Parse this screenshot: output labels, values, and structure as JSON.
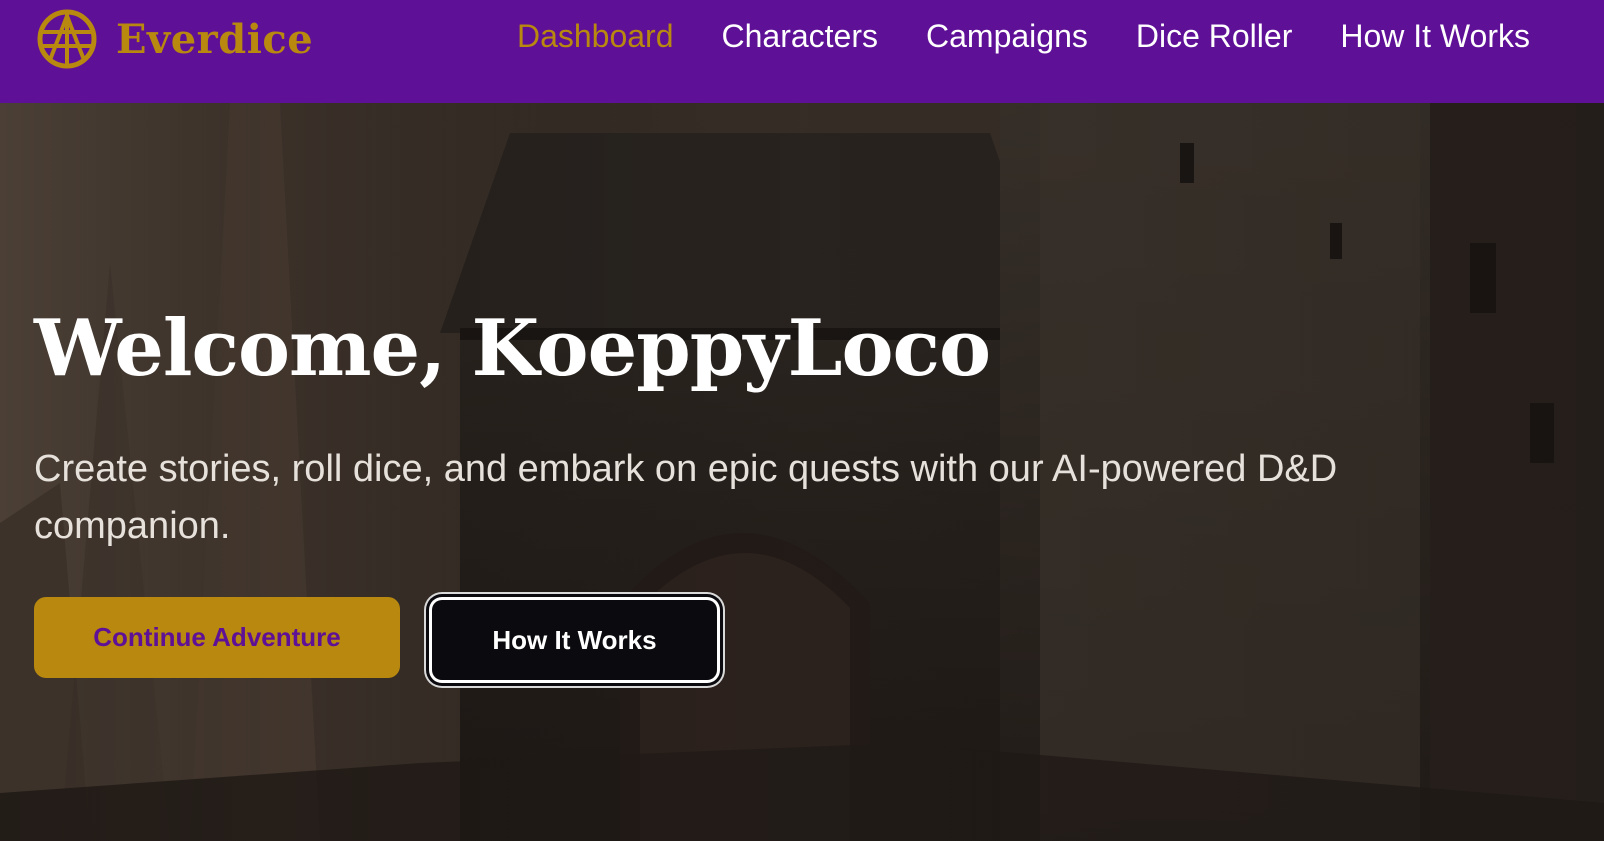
{
  "nav": {
    "brand": "Everdice",
    "brand_icon": "globe-compass-icon",
    "links": [
      {
        "label": "Dashboard",
        "active": true
      },
      {
        "label": "Characters",
        "active": false
      },
      {
        "label": "Campaigns",
        "active": false
      },
      {
        "label": "Dice Roller",
        "active": false
      },
      {
        "label": "How It Works",
        "active": false
      }
    ]
  },
  "hero": {
    "title": "Welcome, KoeppyLoco",
    "subtitle": "Create stories, roll dice, and embark on epic quests with our AI-powered D&D companion.",
    "primary_button": "Continue Adventure",
    "secondary_button": "How It Works",
    "background_image": "castle-gatehouse-image"
  },
  "colors": {
    "navbar": "#5e1096",
    "accent_gold": "#b8880f",
    "button_dark": "#0b0b0f",
    "text_light": "#ffffff"
  }
}
